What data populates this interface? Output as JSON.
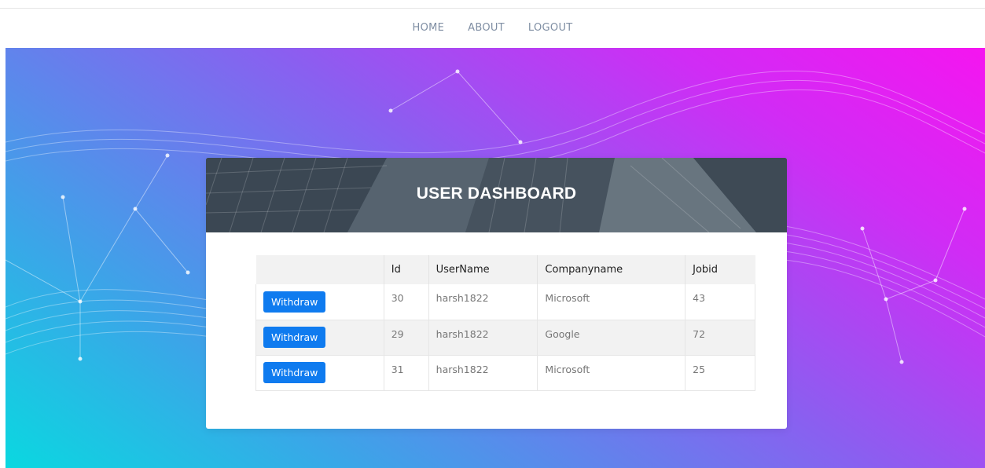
{
  "nav": {
    "items": [
      {
        "label": "HOME"
      },
      {
        "label": "ABOUT"
      },
      {
        "label": "LOGOUT"
      }
    ]
  },
  "dashboard": {
    "title": "USER DASHBOARD"
  },
  "table": {
    "headers": [
      "",
      "Id",
      "UserName",
      "Companyname",
      "Jobid"
    ],
    "rows": [
      {
        "action": "Withdraw",
        "id": "30",
        "username": "harsh1822",
        "company": "Microsoft",
        "jobid": "43"
      },
      {
        "action": "Withdraw",
        "id": "29",
        "username": "harsh1822",
        "company": "Google",
        "jobid": "72"
      },
      {
        "action": "Withdraw",
        "id": "31",
        "username": "harsh1822",
        "company": "Microsoft",
        "jobid": "25"
      }
    ]
  },
  "colors": {
    "accent_button": "#0f7bef",
    "nav_text": "#7f8ea3",
    "gradient_start": "#0ad8e0",
    "gradient_end": "#f515f0"
  }
}
